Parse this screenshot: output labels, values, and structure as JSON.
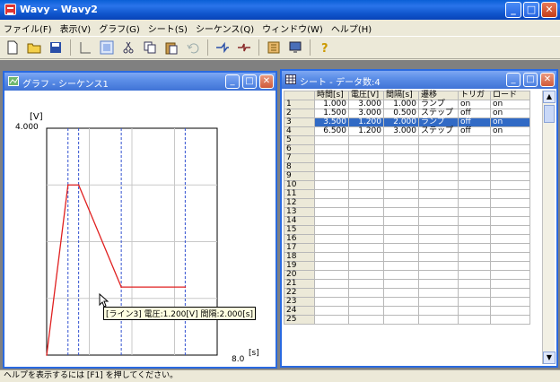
{
  "app": {
    "title": "Wavy - Wavy2",
    "window_buttons": {
      "minimize": "_",
      "maximize": "□",
      "close": "✕"
    }
  },
  "menubar": [
    "ファイル(F)",
    "表示(V)",
    "グラフ(G)",
    "シート(S)",
    "シーケンス(Q)",
    "ウィンドウ(W)",
    "ヘルプ(H)"
  ],
  "toolbar": {
    "icons": [
      "new-file-icon",
      "open-folder-icon",
      "save-icon",
      "graph-view-icon",
      "sheet-view-icon",
      "cut-icon",
      "copy-icon",
      "paste-icon",
      "undo-icon",
      "sequence-run-icon",
      "sequence-stop-icon",
      "device-icon",
      "monitor-icon",
      "help-icon"
    ]
  },
  "graph_window": {
    "title": "グラフ - シーケンス1",
    "y_unit": "[V]",
    "y_top": "4.000",
    "x_right": "8.0",
    "x_unit": "[s]",
    "tooltip": "[ライン3] 電圧:1.200[V] 間隔:2.000[s]"
  },
  "chart_data": {
    "type": "line",
    "title": "",
    "xlabel": "[s]",
    "ylabel": "[V]",
    "xlim": [
      0,
      8.0
    ],
    "ylim": [
      0,
      4.0
    ],
    "series": [
      {
        "x": [
          0,
          1.0,
          1.5,
          3.5,
          6.5
        ],
        "y": [
          0,
          3.0,
          3.0,
          1.2,
          1.2
        ],
        "color": "#e02020"
      }
    ],
    "vlines": [
      1.0,
      1.5,
      3.5,
      6.5
    ],
    "vline_color": "#3050d0",
    "grid": true
  },
  "sheet_window": {
    "title": "シート - データ数:4",
    "columns": [
      "時間[s]",
      "電圧[V]",
      "間隔[s]",
      "遷移",
      "トリガ",
      "ロード"
    ],
    "rows": [
      [
        "1.000",
        "3.000",
        "1.000",
        "ランプ",
        "on",
        "on"
      ],
      [
        "1.500",
        "3.000",
        "0.500",
        "ステップ",
        "off",
        "on"
      ],
      [
        "3.500",
        "1.200",
        "2.000",
        "ランプ",
        "off",
        "on"
      ],
      [
        "6.500",
        "1.200",
        "3.000",
        "ステップ",
        "off",
        "on"
      ]
    ],
    "selected_row": 3,
    "row_numbers": [
      "1",
      "2",
      "3",
      "4",
      "5",
      "6",
      "7",
      "8",
      "9",
      "10",
      "11",
      "12",
      "13",
      "14",
      "15",
      "16",
      "17",
      "18",
      "19",
      "20",
      "21",
      "22",
      "23",
      "24",
      "25"
    ]
  },
  "statusbar": {
    "text": "ヘルプを表示するには [F1] を押してください。"
  },
  "colors": {
    "title_blue": "#0a5fd6",
    "line_red": "#e02020",
    "vline_blue": "#3050d0",
    "selection": "#316ac5"
  }
}
